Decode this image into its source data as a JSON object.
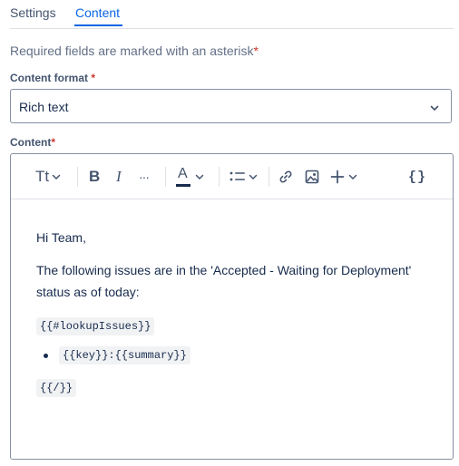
{
  "tabs": {
    "settings_label": "Settings",
    "content_label": "Content"
  },
  "form": {
    "required_note": "Required fields are marked with an asterisk",
    "asterisk": "*",
    "content_format_label": "Content format",
    "content_format_value": "Rich text",
    "content_label": "Content"
  },
  "editor": {
    "toolbar_icons": [
      "text-style-icon",
      "bold-icon",
      "italic-icon",
      "more-formatting-icon",
      "text-color-icon",
      "bullet-list-icon",
      "link-icon",
      "image-icon",
      "insert-plus-icon",
      "code-braces-icon"
    ],
    "text_style_label": "Tt",
    "bold_label": "B",
    "italic_label": "I",
    "more_label": "···",
    "text_color_label": "A",
    "code_label": "{}",
    "greeting": "Hi Team,",
    "body_text": "The following issues are in the 'Accepted - Waiting for Deployment' status as of today:",
    "lookup_open": "{{#lookupIssues}}",
    "bullet_item": "{{key}}:{{summary}}",
    "lookup_close": "{{/}}"
  },
  "colors": {
    "accent": "#0c66e4",
    "required": "#c9372c",
    "text": "#172b4d"
  }
}
